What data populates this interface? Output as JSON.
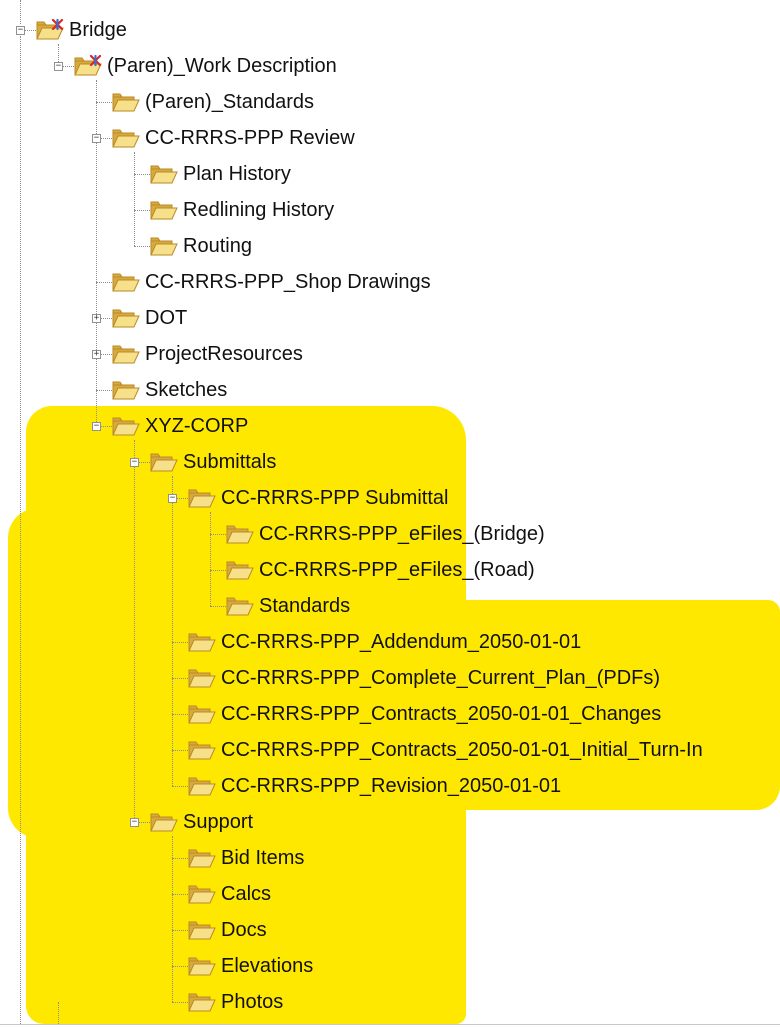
{
  "colors": {
    "highlight": "#ffe800",
    "folder_light": "#f7e08a",
    "folder_dark": "#d8a93c",
    "folder_outline": "#b98a26",
    "special_folder_accent": "#d9262a"
  },
  "tree": [
    {
      "id": "bridge",
      "label": "Bridge",
      "depth": 0,
      "expander": "-",
      "icon": "special-folder-icon"
    },
    {
      "id": "paren-work-description",
      "label": "(Paren)_Work Description",
      "depth": 1,
      "expander": "-",
      "icon": "special-folder-icon"
    },
    {
      "id": "paren-standards",
      "label": "(Paren)_Standards",
      "depth": 2,
      "expander": "",
      "icon": "folder-icon"
    },
    {
      "id": "cc-rrrs-ppp-review",
      "label": "CC-RRRS-PPP Review",
      "depth": 2,
      "expander": "-",
      "icon": "folder-icon"
    },
    {
      "id": "plan-history",
      "label": "Plan History",
      "depth": 3,
      "expander": "",
      "icon": "folder-icon"
    },
    {
      "id": "redlining-history",
      "label": "Redlining History",
      "depth": 3,
      "expander": "",
      "icon": "folder-icon"
    },
    {
      "id": "routing",
      "label": "Routing",
      "depth": 3,
      "expander": "",
      "icon": "folder-icon"
    },
    {
      "id": "shop-drawings",
      "label": "CC-RRRS-PPP_Shop Drawings",
      "depth": 2,
      "expander": "",
      "icon": "folder-icon"
    },
    {
      "id": "dot",
      "label": "DOT",
      "depth": 2,
      "expander": "+",
      "icon": "folder-icon"
    },
    {
      "id": "project-resources",
      "label": "ProjectResources",
      "depth": 2,
      "expander": "+",
      "icon": "folder-icon"
    },
    {
      "id": "sketches",
      "label": "Sketches",
      "depth": 2,
      "expander": "",
      "icon": "folder-icon"
    },
    {
      "id": "xyz-corp",
      "label": "XYZ-CORP",
      "depth": 2,
      "expander": "-",
      "icon": "folder-icon"
    },
    {
      "id": "submittals",
      "label": "Submittals",
      "depth": 3,
      "expander": "-",
      "icon": "folder-icon"
    },
    {
      "id": "submittal",
      "label": "CC-RRRS-PPP Submittal",
      "depth": 4,
      "expander": "-",
      "icon": "folder-icon"
    },
    {
      "id": "efiles-bridge",
      "label": "CC-RRRS-PPP_eFiles_(Bridge)",
      "depth": 5,
      "expander": "",
      "icon": "folder-icon"
    },
    {
      "id": "efiles-road",
      "label": "CC-RRRS-PPP_eFiles_(Road)",
      "depth": 5,
      "expander": "",
      "icon": "folder-icon"
    },
    {
      "id": "standards",
      "label": "Standards",
      "depth": 5,
      "expander": "",
      "icon": "folder-icon"
    },
    {
      "id": "addendum",
      "label": "CC-RRRS-PPP_Addendum_2050-01-01",
      "depth": 4,
      "expander": "",
      "icon": "folder-icon"
    },
    {
      "id": "complete-current-plan",
      "label": "CC-RRRS-PPP_Complete_Current_Plan_(PDFs)",
      "depth": 4,
      "expander": "",
      "icon": "folder-icon"
    },
    {
      "id": "contracts-changes",
      "label": "CC-RRRS-PPP_Contracts_2050-01-01_Changes",
      "depth": 4,
      "expander": "",
      "icon": "folder-icon"
    },
    {
      "id": "contracts-initial",
      "label": "CC-RRRS-PPP_Contracts_2050-01-01_Initial_Turn-In",
      "depth": 4,
      "expander": "",
      "icon": "folder-icon"
    },
    {
      "id": "revision",
      "label": "CC-RRRS-PPP_Revision_2050-01-01",
      "depth": 4,
      "expander": "",
      "icon": "folder-icon"
    },
    {
      "id": "support",
      "label": "Support",
      "depth": 3,
      "expander": "-",
      "icon": "folder-icon"
    },
    {
      "id": "bid-items",
      "label": "Bid Items",
      "depth": 4,
      "expander": "",
      "icon": "folder-icon"
    },
    {
      "id": "calcs",
      "label": "Calcs",
      "depth": 4,
      "expander": "",
      "icon": "folder-icon"
    },
    {
      "id": "docs",
      "label": "Docs",
      "depth": 4,
      "expander": "",
      "icon": "folder-icon"
    },
    {
      "id": "elevations",
      "label": "Elevations",
      "depth": 4,
      "expander": "",
      "icon": "folder-icon"
    },
    {
      "id": "photos",
      "label": "Photos",
      "depth": 4,
      "expander": "",
      "icon": "folder-icon"
    }
  ]
}
